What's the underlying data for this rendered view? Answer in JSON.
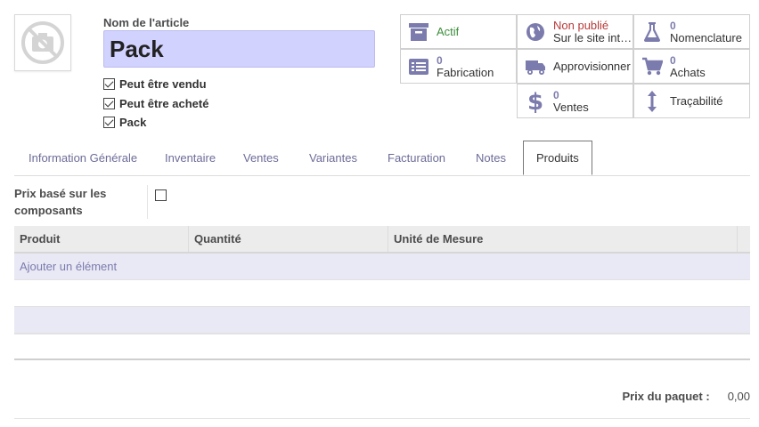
{
  "product": {
    "name_label": "Nom de l'article",
    "name": "Pack",
    "checkboxes": [
      {
        "label": "Peut être vendu",
        "checked": true
      },
      {
        "label": "Peut être acheté",
        "checked": true
      },
      {
        "label": "Pack",
        "checked": true
      }
    ]
  },
  "smart_buttons": {
    "active": {
      "label": "Actif",
      "icon": "archive-icon"
    },
    "website": {
      "status": "Non publié",
      "label": "Sur le site int…",
      "icon": "globe-icon"
    },
    "bom": {
      "count": "0",
      "label": "Nomenclature",
      "icon": "flask-icon"
    },
    "manufacturing": {
      "count": "0",
      "label": "Fabrication",
      "icon": "list-icon"
    },
    "replenish": {
      "label": "Approvisionner",
      "icon": "truck-icon"
    },
    "purchases": {
      "count": "0",
      "label": "Achats",
      "icon": "cart-icon"
    },
    "sales": {
      "count": "0",
      "label": "Ventes",
      "icon": "dollar-icon"
    },
    "traceability": {
      "label": "Traçabilité",
      "icon": "arrows-vertical-icon"
    }
  },
  "tabs": [
    {
      "label": "Information Générale"
    },
    {
      "label": "Inventaire"
    },
    {
      "label": "Ventes"
    },
    {
      "label": "Variantes"
    },
    {
      "label": "Facturation"
    },
    {
      "label": "Notes"
    },
    {
      "label": "Produits",
      "active": true
    }
  ],
  "pack": {
    "price_from_components_label": "Prix basé sur les composants",
    "price_from_components": false,
    "columns": [
      "Produit",
      "Quantité",
      "Unité de Mesure"
    ],
    "add_item": "Ajouter un élément",
    "total_label": "Prix du paquet :",
    "total_value": "0,00"
  },
  "colors": {
    "accent": "#7c7bad",
    "title_bg": "#d2d2ff",
    "active_green": "#3c8e3c",
    "unpublished_red": "#b93a3a"
  }
}
